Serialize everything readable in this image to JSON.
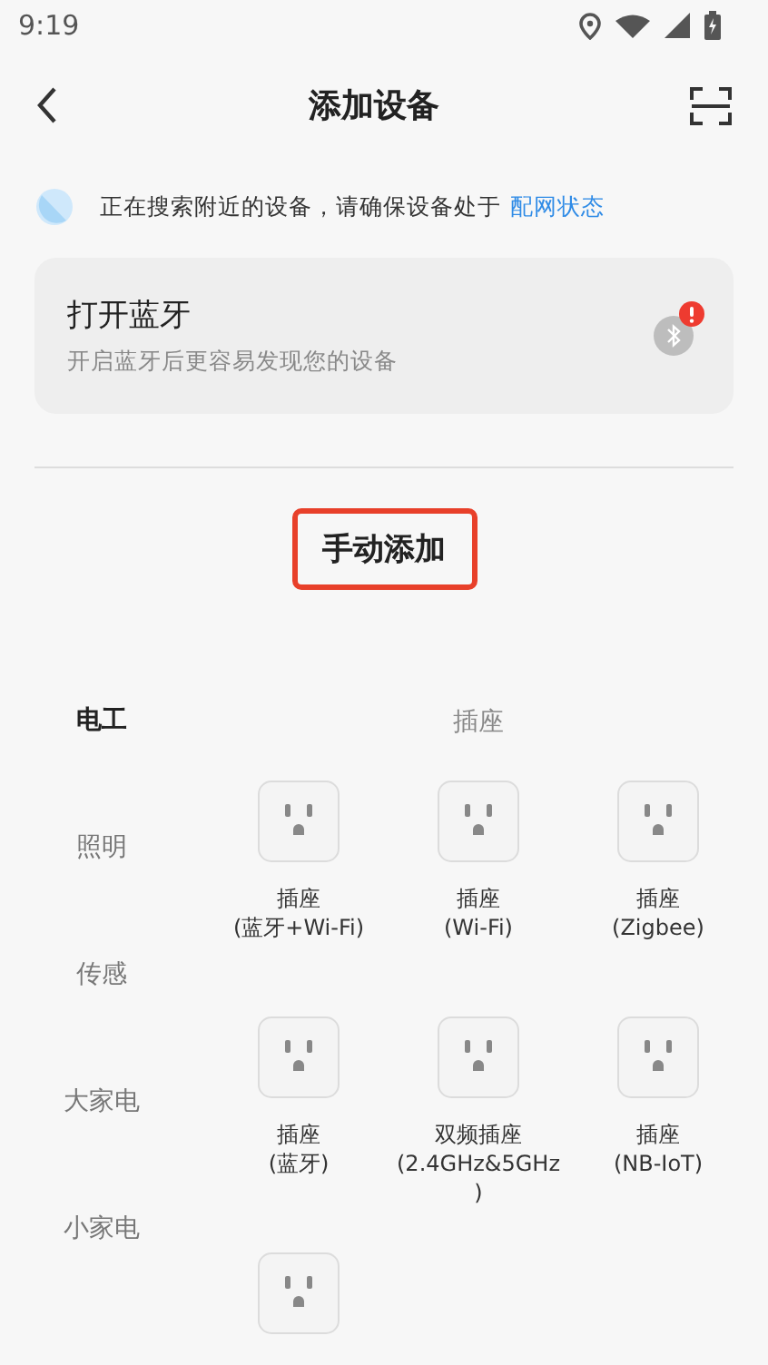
{
  "status_bar": {
    "time": "9:19"
  },
  "header": {
    "title": "添加设备"
  },
  "search_notice": {
    "text": "正在搜索附近的设备，请确保设备处于",
    "link": "配网状态"
  },
  "bluetooth_card": {
    "title": "打开蓝牙",
    "subtitle": "开启蓝牙后更容易发现您的设备",
    "alert": true
  },
  "manual_add": {
    "label": "手动添加",
    "highlighted": true
  },
  "categories": [
    {
      "label": "电工",
      "selected": true
    },
    {
      "label": "照明",
      "selected": false
    },
    {
      "label": "传感",
      "selected": false
    },
    {
      "label": "大家电",
      "selected": false
    },
    {
      "label": "小家电",
      "selected": false
    }
  ],
  "section": {
    "title": "插座"
  },
  "devices": [
    {
      "kind": "labeled",
      "lines": [
        "插座",
        "(蓝牙+Wi-Fi)"
      ]
    },
    {
      "kind": "labeled",
      "lines": [
        "插座",
        "(Wi-Fi)"
      ]
    },
    {
      "kind": "labeled",
      "lines": [
        "插座",
        "(Zigbee)"
      ]
    },
    {
      "kind": "labeled",
      "lines": [
        "插座",
        "(蓝牙)"
      ]
    },
    {
      "kind": "labeled",
      "lines": [
        "双频插座",
        "(2.4GHz&5GHz",
        ")"
      ]
    },
    {
      "kind": "labeled",
      "lines": [
        "插座",
        "(NB-IoT)"
      ]
    },
    {
      "kind": "icon_only"
    }
  ]
}
